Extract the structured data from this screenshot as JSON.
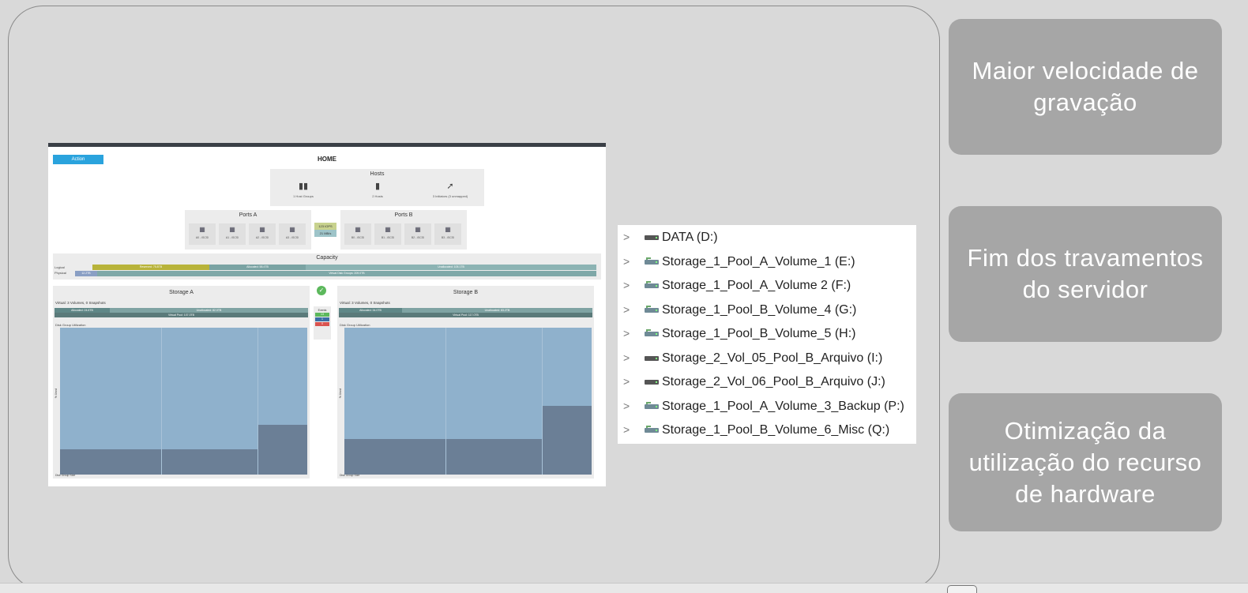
{
  "storage_ui": {
    "action_label": "Action",
    "home_title": "HOME",
    "hosts": {
      "title": "Hosts",
      "items": [
        {
          "icon": "host-groups-icon",
          "label": "1 Host Groups"
        },
        {
          "icon": "hosts-icon",
          "label": "2 Hosts"
        },
        {
          "icon": "initiators-icon",
          "label": "3 Initiators (3 unmapped)"
        }
      ]
    },
    "ports_a": {
      "title": "Ports A",
      "ports": [
        "A0 - iSCSI",
        "A1 - iSCSI",
        "A2 - iSCSI",
        "A3 - iSCSI"
      ]
    },
    "ports_b": {
      "title": "Ports B",
      "ports": [
        "B0 - iSCSI",
        "B1 - iSCSI",
        "B2 - iSCSI",
        "B3 - iSCSI"
      ]
    },
    "iops": {
      "top": "123 IOPS",
      "bottom": "21 MB/s"
    },
    "capacity": {
      "title": "Capacity",
      "logical_label": "Logical",
      "physical_label": "Physical",
      "reserved": "Reserved: 75.8TB",
      "allocated": "Allocated: 58.4TB",
      "unallocated": "Unallocated: 105.1TB",
      "physical_used": "12.2TB",
      "virtual_disk_groups": "Virtual Disk Groups: 209.0TB"
    },
    "storage_a": {
      "title": "Storage A",
      "virtual": "Virtual: 3 Volumes, 0 Snapshots",
      "allocated": "Allocated: 24.6TB",
      "unallocated": "Unallocated: 82.0TB",
      "virtual_pool": "Virtual Pool: 107.0TB",
      "utilization_label": "Disk Group Utilization",
      "axis_label": "% Used",
      "size_label": "Disk Group Size",
      "bars": [
        0.17,
        0.17,
        0.34
      ]
    },
    "storage_b": {
      "title": "Storage B",
      "virtual": "Virtual: 3 Volumes, 0 Snapshots",
      "allocated": "Allocated: 34.0TB",
      "unallocated": "Unallocated: 83.2TB",
      "virtual_pool": "Virtual Pool: 117.0TB",
      "utilization_label": "Disk Group Utilization",
      "axis_label": "% Used",
      "size_label": "Disk Group Size",
      "bars": [
        0.24,
        0.24,
        0.47
      ]
    },
    "events": {
      "title": "Events",
      "counts": [
        "13",
        "1",
        "0"
      ]
    }
  },
  "drives": [
    {
      "label": "DATA (D:)",
      "type": "local"
    },
    {
      "label": "Storage_1_Pool_A_Volume_1 (E:)",
      "type": "network"
    },
    {
      "label": "Storage_1_Pool_A_Volume 2 (F:)",
      "type": "network"
    },
    {
      "label": "Storage_1_Pool_B_Volume_4 (G:)",
      "type": "network"
    },
    {
      "label": "Storage_1_Pool_B_Volume_5 (H:)",
      "type": "network"
    },
    {
      "label": "Storage_2_Vol_05_Pool_B_Arquivo (I:)",
      "type": "local"
    },
    {
      "label": "Storage_2_Vol_06_Pool_B_Arquivo (J:)",
      "type": "local"
    },
    {
      "label": "Storage_1_Pool_A_Volume_3_Backup (P:)",
      "type": "network"
    },
    {
      "label": "Storage_1_Pool_B_Volume_6_Misc (Q:)",
      "type": "network"
    }
  ],
  "benefits": [
    "Maior velocidade de gravação",
    "Fim dos travamentos do servidor",
    "Otimização da utilização do recurso de hardware"
  ],
  "colors": {
    "card_bg": "#a6a6a6",
    "action_blue": "#2aa3dd",
    "bar_light": "#8fb1cc",
    "bar_dark": "#6b7f96"
  }
}
